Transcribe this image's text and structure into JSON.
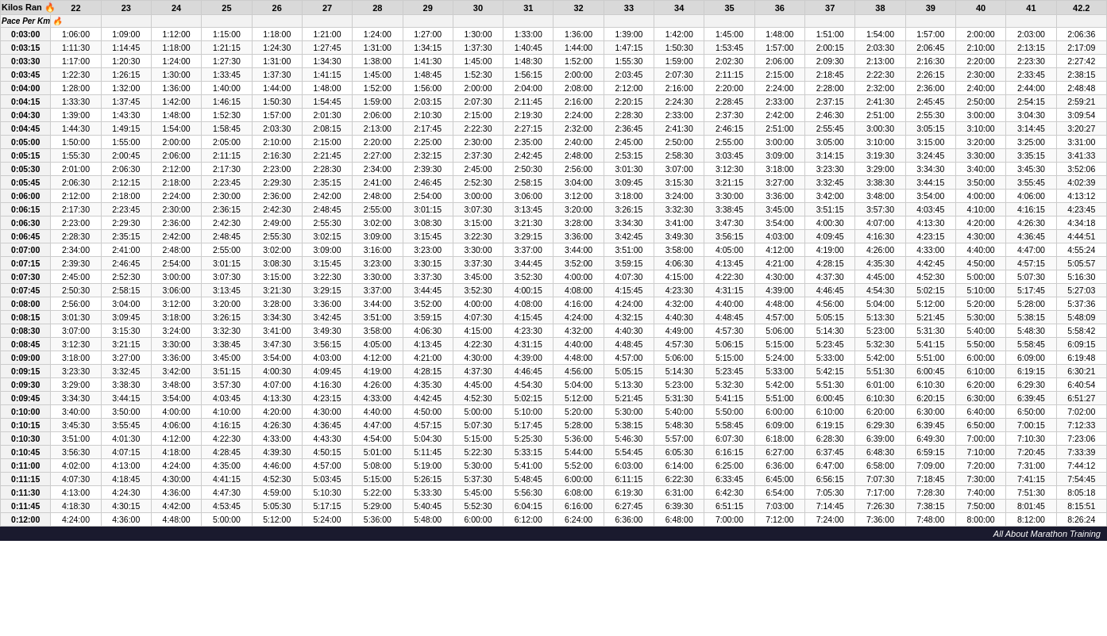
{
  "table": {
    "col_headers": [
      "Kilos Ran 🔥",
      "22",
      "23",
      "24",
      "25",
      "26",
      "27",
      "28",
      "29",
      "30",
      "31",
      "32",
      "33",
      "34",
      "35",
      "36",
      "37",
      "38",
      "39",
      "40",
      "41",
      "42.2"
    ],
    "row2_headers": [
      "Pace Per Km 🔥",
      "",
      "",
      "",
      "",
      "",
      "",
      "",
      "",
      "",
      "",
      "",
      "",
      "",
      "",
      "",
      "",
      "",
      "",
      "",
      "",
      ""
    ],
    "rows": [
      [
        "0:03:00",
        "1:06:00",
        "1:09:00",
        "1:12:00",
        "1:15:00",
        "1:18:00",
        "1:21:00",
        "1:24:00",
        "1:27:00",
        "1:30:00",
        "1:33:00",
        "1:36:00",
        "1:39:00",
        "1:42:00",
        "1:45:00",
        "1:48:00",
        "1:51:00",
        "1:54:00",
        "1:57:00",
        "2:00:00",
        "2:03:00",
        "2:06:36"
      ],
      [
        "0:03:15",
        "1:11:30",
        "1:14:45",
        "1:18:00",
        "1:21:15",
        "1:24:30",
        "1:27:45",
        "1:31:00",
        "1:34:15",
        "1:37:30",
        "1:40:45",
        "1:44:00",
        "1:47:15",
        "1:50:30",
        "1:53:45",
        "1:57:00",
        "2:00:15",
        "2:03:30",
        "2:06:45",
        "2:10:00",
        "2:13:15",
        "2:17:09"
      ],
      [
        "0:03:30",
        "1:17:00",
        "1:20:30",
        "1:24:00",
        "1:27:30",
        "1:31:00",
        "1:34:30",
        "1:38:00",
        "1:41:30",
        "1:45:00",
        "1:48:30",
        "1:52:00",
        "1:55:30",
        "1:59:00",
        "2:02:30",
        "2:06:00",
        "2:09:30",
        "2:13:00",
        "2:16:30",
        "2:20:00",
        "2:23:30",
        "2:27:42"
      ],
      [
        "0:03:45",
        "1:22:30",
        "1:26:15",
        "1:30:00",
        "1:33:45",
        "1:37:30",
        "1:41:15",
        "1:45:00",
        "1:48:45",
        "1:52:30",
        "1:56:15",
        "2:00:00",
        "2:03:45",
        "2:07:30",
        "2:11:15",
        "2:15:00",
        "2:18:45",
        "2:22:30",
        "2:26:15",
        "2:30:00",
        "2:33:45",
        "2:38:15"
      ],
      [
        "0:04:00",
        "1:28:00",
        "1:32:00",
        "1:36:00",
        "1:40:00",
        "1:44:00",
        "1:48:00",
        "1:52:00",
        "1:56:00",
        "2:00:00",
        "2:04:00",
        "2:08:00",
        "2:12:00",
        "2:16:00",
        "2:20:00",
        "2:24:00",
        "2:28:00",
        "2:32:00",
        "2:36:00",
        "2:40:00",
        "2:44:00",
        "2:48:48"
      ],
      [
        "0:04:15",
        "1:33:30",
        "1:37:45",
        "1:42:00",
        "1:46:15",
        "1:50:30",
        "1:54:45",
        "1:59:00",
        "2:03:15",
        "2:07:30",
        "2:11:45",
        "2:16:00",
        "2:20:15",
        "2:24:30",
        "2:28:45",
        "2:33:00",
        "2:37:15",
        "2:41:30",
        "2:45:45",
        "2:50:00",
        "2:54:15",
        "2:59:21"
      ],
      [
        "0:04:30",
        "1:39:00",
        "1:43:30",
        "1:48:00",
        "1:52:30",
        "1:57:00",
        "2:01:30",
        "2:06:00",
        "2:10:30",
        "2:15:00",
        "2:19:30",
        "2:24:00",
        "2:28:30",
        "2:33:00",
        "2:37:30",
        "2:42:00",
        "2:46:30",
        "2:51:00",
        "2:55:30",
        "3:00:00",
        "3:04:30",
        "3:09:54"
      ],
      [
        "0:04:45",
        "1:44:30",
        "1:49:15",
        "1:54:00",
        "1:58:45",
        "2:03:30",
        "2:08:15",
        "2:13:00",
        "2:17:45",
        "2:22:30",
        "2:27:15",
        "2:32:00",
        "2:36:45",
        "2:41:30",
        "2:46:15",
        "2:51:00",
        "2:55:45",
        "3:00:30",
        "3:05:15",
        "3:10:00",
        "3:14:45",
        "3:20:27"
      ],
      [
        "0:05:00",
        "1:50:00",
        "1:55:00",
        "2:00:00",
        "2:05:00",
        "2:10:00",
        "2:15:00",
        "2:20:00",
        "2:25:00",
        "2:30:00",
        "2:35:00",
        "2:40:00",
        "2:45:00",
        "2:50:00",
        "2:55:00",
        "3:00:00",
        "3:05:00",
        "3:10:00",
        "3:15:00",
        "3:20:00",
        "3:25:00",
        "3:31:00"
      ],
      [
        "0:05:15",
        "1:55:30",
        "2:00:45",
        "2:06:00",
        "2:11:15",
        "2:16:30",
        "2:21:45",
        "2:27:00",
        "2:32:15",
        "2:37:30",
        "2:42:45",
        "2:48:00",
        "2:53:15",
        "2:58:30",
        "3:03:45",
        "3:09:00",
        "3:14:15",
        "3:19:30",
        "3:24:45",
        "3:30:00",
        "3:35:15",
        "3:41:33"
      ],
      [
        "0:05:30",
        "2:01:00",
        "2:06:30",
        "2:12:00",
        "2:17:30",
        "2:23:00",
        "2:28:30",
        "2:34:00",
        "2:39:30",
        "2:45:00",
        "2:50:30",
        "2:56:00",
        "3:01:30",
        "3:07:00",
        "3:12:30",
        "3:18:00",
        "3:23:30",
        "3:29:00",
        "3:34:30",
        "3:40:00",
        "3:45:30",
        "3:52:06"
      ],
      [
        "0:05:45",
        "2:06:30",
        "2:12:15",
        "2:18:00",
        "2:23:45",
        "2:29:30",
        "2:35:15",
        "2:41:00",
        "2:46:45",
        "2:52:30",
        "2:58:15",
        "3:04:00",
        "3:09:45",
        "3:15:30",
        "3:21:15",
        "3:27:00",
        "3:32:45",
        "3:38:30",
        "3:44:15",
        "3:50:00",
        "3:55:45",
        "4:02:39"
      ],
      [
        "0:06:00",
        "2:12:00",
        "2:18:00",
        "2:24:00",
        "2:30:00",
        "2:36:00",
        "2:42:00",
        "2:48:00",
        "2:54:00",
        "3:00:00",
        "3:06:00",
        "3:12:00",
        "3:18:00",
        "3:24:00",
        "3:30:00",
        "3:36:00",
        "3:42:00",
        "3:48:00",
        "3:54:00",
        "4:00:00",
        "4:06:00",
        "4:13:12"
      ],
      [
        "0:06:15",
        "2:17:30",
        "2:23:45",
        "2:30:00",
        "2:36:15",
        "2:42:30",
        "2:48:45",
        "2:55:00",
        "3:01:15",
        "3:07:30",
        "3:13:45",
        "3:20:00",
        "3:26:15",
        "3:32:30",
        "3:38:45",
        "3:45:00",
        "3:51:15",
        "3:57:30",
        "4:03:45",
        "4:10:00",
        "4:16:15",
        "4:23:45"
      ],
      [
        "0:06:30",
        "2:23:00",
        "2:29:30",
        "2:36:00",
        "2:42:30",
        "2:49:00",
        "2:55:30",
        "3:02:00",
        "3:08:30",
        "3:15:00",
        "3:21:30",
        "3:28:00",
        "3:34:30",
        "3:41:00",
        "3:47:30",
        "3:54:00",
        "4:00:30",
        "4:07:00",
        "4:13:30",
        "4:20:00",
        "4:26:30",
        "4:34:18"
      ],
      [
        "0:06:45",
        "2:28:30",
        "2:35:15",
        "2:42:00",
        "2:48:45",
        "2:55:30",
        "3:02:15",
        "3:09:00",
        "3:15:45",
        "3:22:30",
        "3:29:15",
        "3:36:00",
        "3:42:45",
        "3:49:30",
        "3:56:15",
        "4:03:00",
        "4:09:45",
        "4:16:30",
        "4:23:15",
        "4:30:00",
        "4:36:45",
        "4:44:51"
      ],
      [
        "0:07:00",
        "2:34:00",
        "2:41:00",
        "2:48:00",
        "2:55:00",
        "3:02:00",
        "3:09:00",
        "3:16:00",
        "3:23:00",
        "3:30:00",
        "3:37:00",
        "3:44:00",
        "3:51:00",
        "3:58:00",
        "4:05:00",
        "4:12:00",
        "4:19:00",
        "4:26:00",
        "4:33:00",
        "4:40:00",
        "4:47:00",
        "4:55:24"
      ],
      [
        "0:07:15",
        "2:39:30",
        "2:46:45",
        "2:54:00",
        "3:01:15",
        "3:08:30",
        "3:15:45",
        "3:23:00",
        "3:30:15",
        "3:37:30",
        "3:44:45",
        "3:52:00",
        "3:59:15",
        "4:06:30",
        "4:13:45",
        "4:21:00",
        "4:28:15",
        "4:35:30",
        "4:42:45",
        "4:50:00",
        "4:57:15",
        "5:05:57"
      ],
      [
        "0:07:30",
        "2:45:00",
        "2:52:30",
        "3:00:00",
        "3:07:30",
        "3:15:00",
        "3:22:30",
        "3:30:00",
        "3:37:30",
        "3:45:00",
        "3:52:30",
        "4:00:00",
        "4:07:30",
        "4:15:00",
        "4:22:30",
        "4:30:00",
        "4:37:30",
        "4:45:00",
        "4:52:30",
        "5:00:00",
        "5:07:30",
        "5:16:30"
      ],
      [
        "0:07:45",
        "2:50:30",
        "2:58:15",
        "3:06:00",
        "3:13:45",
        "3:21:30",
        "3:29:15",
        "3:37:00",
        "3:44:45",
        "3:52:30",
        "4:00:15",
        "4:08:00",
        "4:15:45",
        "4:23:30",
        "4:31:15",
        "4:39:00",
        "4:46:45",
        "4:54:30",
        "5:02:15",
        "5:10:00",
        "5:17:45",
        "5:27:03"
      ],
      [
        "0:08:00",
        "2:56:00",
        "3:04:00",
        "3:12:00",
        "3:20:00",
        "3:28:00",
        "3:36:00",
        "3:44:00",
        "3:52:00",
        "4:00:00",
        "4:08:00",
        "4:16:00",
        "4:24:00",
        "4:32:00",
        "4:40:00",
        "4:48:00",
        "4:56:00",
        "5:04:00",
        "5:12:00",
        "5:20:00",
        "5:28:00",
        "5:37:36"
      ],
      [
        "0:08:15",
        "3:01:30",
        "3:09:45",
        "3:18:00",
        "3:26:15",
        "3:34:30",
        "3:42:45",
        "3:51:00",
        "3:59:15",
        "4:07:30",
        "4:15:45",
        "4:24:00",
        "4:32:15",
        "4:40:30",
        "4:48:45",
        "4:57:00",
        "5:05:15",
        "5:13:30",
        "5:21:45",
        "5:30:00",
        "5:38:15",
        "5:48:09"
      ],
      [
        "0:08:30",
        "3:07:00",
        "3:15:30",
        "3:24:00",
        "3:32:30",
        "3:41:00",
        "3:49:30",
        "3:58:00",
        "4:06:30",
        "4:15:00",
        "4:23:30",
        "4:32:00",
        "4:40:30",
        "4:49:00",
        "4:57:30",
        "5:06:00",
        "5:14:30",
        "5:23:00",
        "5:31:30",
        "5:40:00",
        "5:48:30",
        "5:58:42"
      ],
      [
        "0:08:45",
        "3:12:30",
        "3:21:15",
        "3:30:00",
        "3:38:45",
        "3:47:30",
        "3:56:15",
        "4:05:00",
        "4:13:45",
        "4:22:30",
        "4:31:15",
        "4:40:00",
        "4:48:45",
        "4:57:30",
        "5:06:15",
        "5:15:00",
        "5:23:45",
        "5:32:30",
        "5:41:15",
        "5:50:00",
        "5:58:45",
        "6:09:15"
      ],
      [
        "0:09:00",
        "3:18:00",
        "3:27:00",
        "3:36:00",
        "3:45:00",
        "3:54:00",
        "4:03:00",
        "4:12:00",
        "4:21:00",
        "4:30:00",
        "4:39:00",
        "4:48:00",
        "4:57:00",
        "5:06:00",
        "5:15:00",
        "5:24:00",
        "5:33:00",
        "5:42:00",
        "5:51:00",
        "6:00:00",
        "6:09:00",
        "6:19:48"
      ],
      [
        "0:09:15",
        "3:23:30",
        "3:32:45",
        "3:42:00",
        "3:51:15",
        "4:00:30",
        "4:09:45",
        "4:19:00",
        "4:28:15",
        "4:37:30",
        "4:46:45",
        "4:56:00",
        "5:05:15",
        "5:14:30",
        "5:23:45",
        "5:33:00",
        "5:42:15",
        "5:51:30",
        "6:00:45",
        "6:10:00",
        "6:19:15",
        "6:30:21"
      ],
      [
        "0:09:30",
        "3:29:00",
        "3:38:30",
        "3:48:00",
        "3:57:30",
        "4:07:00",
        "4:16:30",
        "4:26:00",
        "4:35:30",
        "4:45:00",
        "4:54:30",
        "5:04:00",
        "5:13:30",
        "5:23:00",
        "5:32:30",
        "5:42:00",
        "5:51:30",
        "6:01:00",
        "6:10:30",
        "6:20:00",
        "6:29:30",
        "6:40:54"
      ],
      [
        "0:09:45",
        "3:34:30",
        "3:44:15",
        "3:54:00",
        "4:03:45",
        "4:13:30",
        "4:23:15",
        "4:33:00",
        "4:42:45",
        "4:52:30",
        "5:02:15",
        "5:12:00",
        "5:21:45",
        "5:31:30",
        "5:41:15",
        "5:51:00",
        "6:00:45",
        "6:10:30",
        "6:20:15",
        "6:30:00",
        "6:39:45",
        "6:51:27"
      ],
      [
        "0:10:00",
        "3:40:00",
        "3:50:00",
        "4:00:00",
        "4:10:00",
        "4:20:00",
        "4:30:00",
        "4:40:00",
        "4:50:00",
        "5:00:00",
        "5:10:00",
        "5:20:00",
        "5:30:00",
        "5:40:00",
        "5:50:00",
        "6:00:00",
        "6:10:00",
        "6:20:00",
        "6:30:00",
        "6:40:00",
        "6:50:00",
        "7:02:00"
      ],
      [
        "0:10:15",
        "3:45:30",
        "3:55:45",
        "4:06:00",
        "4:16:15",
        "4:26:30",
        "4:36:45",
        "4:47:00",
        "4:57:15",
        "5:07:30",
        "5:17:45",
        "5:28:00",
        "5:38:15",
        "5:48:30",
        "5:58:45",
        "6:09:00",
        "6:19:15",
        "6:29:30",
        "6:39:45",
        "6:50:00",
        "7:00:15",
        "7:12:33"
      ],
      [
        "0:10:30",
        "3:51:00",
        "4:01:30",
        "4:12:00",
        "4:22:30",
        "4:33:00",
        "4:43:30",
        "4:54:00",
        "5:04:30",
        "5:15:00",
        "5:25:30",
        "5:36:00",
        "5:46:30",
        "5:57:00",
        "6:07:30",
        "6:18:00",
        "6:28:30",
        "6:39:00",
        "6:49:30",
        "7:00:00",
        "7:10:30",
        "7:23:06"
      ],
      [
        "0:10:45",
        "3:56:30",
        "4:07:15",
        "4:18:00",
        "4:28:45",
        "4:39:30",
        "4:50:15",
        "5:01:00",
        "5:11:45",
        "5:22:30",
        "5:33:15",
        "5:44:00",
        "5:54:45",
        "6:05:30",
        "6:16:15",
        "6:27:00",
        "6:37:45",
        "6:48:30",
        "6:59:15",
        "7:10:00",
        "7:20:45",
        "7:33:39"
      ],
      [
        "0:11:00",
        "4:02:00",
        "4:13:00",
        "4:24:00",
        "4:35:00",
        "4:46:00",
        "4:57:00",
        "5:08:00",
        "5:19:00",
        "5:30:00",
        "5:41:00",
        "5:52:00",
        "6:03:00",
        "6:14:00",
        "6:25:00",
        "6:36:00",
        "6:47:00",
        "6:58:00",
        "7:09:00",
        "7:20:00",
        "7:31:00",
        "7:44:12"
      ],
      [
        "0:11:15",
        "4:07:30",
        "4:18:45",
        "4:30:00",
        "4:41:15",
        "4:52:30",
        "5:03:45",
        "5:15:00",
        "5:26:15",
        "5:37:30",
        "5:48:45",
        "6:00:00",
        "6:11:15",
        "6:22:30",
        "6:33:45",
        "6:45:00",
        "6:56:15",
        "7:07:30",
        "7:18:45",
        "7:30:00",
        "7:41:15",
        "7:54:45"
      ],
      [
        "0:11:30",
        "4:13:00",
        "4:24:30",
        "4:36:00",
        "4:47:30",
        "4:59:00",
        "5:10:30",
        "5:22:00",
        "5:33:30",
        "5:45:00",
        "5:56:30",
        "6:08:00",
        "6:19:30",
        "6:31:00",
        "6:42:30",
        "6:54:00",
        "7:05:30",
        "7:17:00",
        "7:28:30",
        "7:40:00",
        "7:51:30",
        "8:05:18"
      ],
      [
        "0:11:45",
        "4:18:30",
        "4:30:15",
        "4:42:00",
        "4:53:45",
        "5:05:30",
        "5:17:15",
        "5:29:00",
        "5:40:45",
        "5:52:30",
        "6:04:15",
        "6:16:00",
        "6:27:45",
        "6:39:30",
        "6:51:15",
        "7:03:00",
        "7:14:45",
        "7:26:30",
        "7:38:15",
        "7:50:00",
        "8:01:45",
        "8:15:51"
      ],
      [
        "0:12:00",
        "4:24:00",
        "4:36:00",
        "4:48:00",
        "5:00:00",
        "5:12:00",
        "5:24:00",
        "5:36:00",
        "5:48:00",
        "6:00:00",
        "6:12:00",
        "6:24:00",
        "6:36:00",
        "6:48:00",
        "7:00:00",
        "7:12:00",
        "7:24:00",
        "7:36:00",
        "7:48:00",
        "8:00:00",
        "8:12:00",
        "8:26:24"
      ]
    ]
  },
  "footer": {
    "text": "All About Marathon Training"
  }
}
